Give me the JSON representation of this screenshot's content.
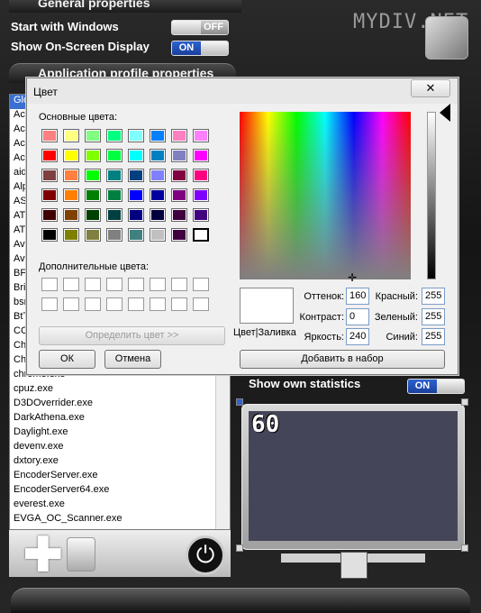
{
  "app": {
    "general_title": "General properties",
    "start_with_windows": "Start with Windows",
    "start_toggle": "OFF",
    "show_osd": "Show On-Screen Display",
    "osd_toggle": "ON",
    "logo": "MYDIV.NET",
    "profile_title": "Application profile properties",
    "show_stats": "Show own statistics",
    "stats_toggle": "ON",
    "fps": "60"
  },
  "app_list": {
    "items": [
      "Glo",
      "Ac",
      "Ac",
      "Ac",
      "Ac",
      "aid",
      "Alp",
      "AS",
      "AT",
      "AT",
      "Av",
      "Av",
      "BF",
      "Bri",
      "bsr",
      "BtT",
      "CC",
      "Ch",
      "Ch",
      "chrome.exe",
      "cpuz.exe",
      "D3DOverrider.exe",
      "DarkAthena.exe",
      "Daylight.exe",
      "devenv.exe",
      "dxtory.exe",
      "EncoderServer.exe",
      "EncoderServer64.exe",
      "everest.exe",
      "EVGA_OC_Scanner.exe"
    ]
  },
  "dialog": {
    "title": "Цвет",
    "close": "✕",
    "basic_colors_label": "Основные цвета:",
    "custom_colors_label": "Дополнительные цвета:",
    "define_button": "Определить цвет >>",
    "ok_button": "ОК",
    "cancel_button": "Отмена",
    "add_button": "Добавить в набор",
    "preview_label": "Цвет|Заливка",
    "hue_label": "Оттенок:",
    "hue_value": "160",
    "sat_label": "Контраст:",
    "sat_value": "0",
    "lum_label": "Яркость:",
    "lum_value": "240",
    "red_label": "Красный:",
    "red_value": "255",
    "green_label": "Зеленый:",
    "green_value": "255",
    "blue_label": "Синий:",
    "blue_value": "255"
  },
  "basic_colors": [
    "#ff8080",
    "#ffff80",
    "#80ff80",
    "#00ff80",
    "#80ffff",
    "#0080ff",
    "#ff80c0",
    "#ff80ff",
    "#ff0000",
    "#ffff00",
    "#80ff00",
    "#00ff40",
    "#00ffff",
    "#0080c0",
    "#8080c0",
    "#ff00ff",
    "#804040",
    "#ff8040",
    "#00ff00",
    "#008080",
    "#004080",
    "#8080ff",
    "#800040",
    "#ff0080",
    "#800000",
    "#ff8000",
    "#008000",
    "#008040",
    "#0000ff",
    "#0000a0",
    "#800080",
    "#8000ff",
    "#400000",
    "#804000",
    "#004000",
    "#004040",
    "#000080",
    "#000040",
    "#400040",
    "#400080",
    "#000000",
    "#808000",
    "#808040",
    "#808080",
    "#408080",
    "#c0c0c0",
    "#400040",
    "#ffffff"
  ]
}
